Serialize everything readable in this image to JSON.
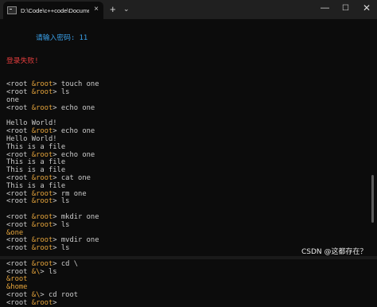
{
  "window": {
    "tab_title": "D:\\Code\\c++code\\Document",
    "tab_close": "×",
    "new_tab": "+",
    "dropdown": "⌄",
    "minimize": "—",
    "maximize": "☐",
    "close": "✕"
  },
  "terminal": {
    "password_prompt": "请输入密码: 11",
    "login_failed": "登录失败!",
    "lines": [
      {
        "kind": "cmd",
        "user": "root",
        "host": "root",
        "path": "",
        "cmd": "touch one"
      },
      {
        "kind": "cmd",
        "user": "root",
        "host": "root",
        "path": "",
        "cmd": "ls"
      },
      {
        "kind": "out",
        "text": "one"
      },
      {
        "kind": "cmd",
        "user": "root",
        "host": "root",
        "path": "",
        "cmd": "echo one"
      },
      {
        "kind": "blank",
        "text": ""
      },
      {
        "kind": "out",
        "text": "Hello World!"
      },
      {
        "kind": "cmd",
        "user": "root",
        "host": "root",
        "path": "",
        "cmd": "echo one"
      },
      {
        "kind": "out",
        "text": "Hello World!"
      },
      {
        "kind": "out",
        "text": "This is a file"
      },
      {
        "kind": "cmd",
        "user": "root",
        "host": "root",
        "path": "",
        "cmd": "echo one"
      },
      {
        "kind": "out",
        "text": "This is a file"
      },
      {
        "kind": "out",
        "text": "This is a file"
      },
      {
        "kind": "cmd",
        "user": "root",
        "host": "root",
        "path": "",
        "cmd": "cat one"
      },
      {
        "kind": "out",
        "text": "This is a file"
      },
      {
        "kind": "cmd",
        "user": "root",
        "host": "root",
        "path": "",
        "cmd": "rm one"
      },
      {
        "kind": "cmd",
        "user": "root",
        "host": "root",
        "path": "",
        "cmd": "ls"
      },
      {
        "kind": "blank",
        "text": ""
      },
      {
        "kind": "cmd",
        "user": "root",
        "host": "root",
        "path": "",
        "cmd": "mkdir one"
      },
      {
        "kind": "cmd",
        "user": "root",
        "host": "root",
        "path": "",
        "cmd": "ls"
      },
      {
        "kind": "dir",
        "text": "&one"
      },
      {
        "kind": "cmd",
        "user": "root",
        "host": "root",
        "path": "",
        "cmd": "mvdir one"
      },
      {
        "kind": "cmd",
        "user": "root",
        "host": "root",
        "path": "",
        "cmd": "ls"
      },
      {
        "kind": "blank",
        "text": ""
      },
      {
        "kind": "cmd",
        "user": "root",
        "host": "root",
        "path": "",
        "cmd": "cd \\"
      },
      {
        "kind": "cmd2",
        "user": "root",
        "path": "\\",
        "cmd": "ls"
      },
      {
        "kind": "dir",
        "text": "&root"
      },
      {
        "kind": "dir",
        "text": "&home"
      },
      {
        "kind": "cmd2",
        "user": "root",
        "path": "\\",
        "cmd": "cd root"
      },
      {
        "kind": "cmd",
        "user": "root",
        "host": "root",
        "path": "",
        "cmd": ""
      }
    ]
  },
  "watermark": "CSDN @这都存在？",
  "colors": {
    "background": "#0c0c0c",
    "titlebar": "#202020",
    "text": "#cccccc",
    "amp_host": "#e5a43b",
    "error": "#e23d3d",
    "password": "#3aa0e8"
  }
}
